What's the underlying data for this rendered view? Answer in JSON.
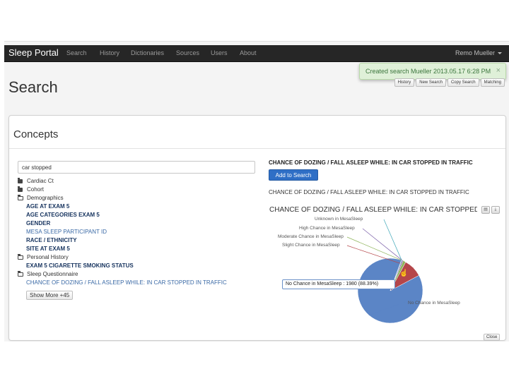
{
  "navbar": {
    "brand": "Sleep Portal",
    "items": [
      "Search",
      "History",
      "Dictionaries",
      "Sources",
      "Users",
      "About"
    ],
    "user": "Remo Mueller"
  },
  "toast": {
    "message": "Created search Mueller 2013.05.17 6:28 PM",
    "close": "×"
  },
  "page": {
    "title": "Search",
    "buttons": [
      "History",
      "New Search",
      "Copy Search",
      "Matching"
    ]
  },
  "concepts": {
    "title": "Concepts",
    "search_value": "car stopped",
    "tree": [
      {
        "label": "Cardiac Ct",
        "kind": "folder-closed"
      },
      {
        "label": "Cohort",
        "kind": "folder-closed"
      },
      {
        "label": "Demographics",
        "kind": "folder-open"
      },
      {
        "label": "AGE AT EXAM 5",
        "kind": "child"
      },
      {
        "label": "AGE CATEGORIES EXAM 5",
        "kind": "child"
      },
      {
        "label": "GENDER",
        "kind": "child"
      },
      {
        "label": "MESA SLEEP PARTICIPANT ID",
        "kind": "child-link"
      },
      {
        "label": "RACE / ETHNICITY",
        "kind": "child"
      },
      {
        "label": "SITE AT EXAM 5",
        "kind": "child"
      },
      {
        "label": "Personal History",
        "kind": "folder-open"
      },
      {
        "label": "EXAM 5 CIGARETTE SMOKING STATUS",
        "kind": "child"
      },
      {
        "label": "Sleep Questionnaire",
        "kind": "folder-open"
      },
      {
        "label": "CHANCE OF DOZING / FALL ASLEEP WHILE: IN CAR STOPPED IN TRAFFIC",
        "kind": "child-link"
      }
    ],
    "show_more": "Show More +45"
  },
  "variable": {
    "title": "CHANCE OF DOZING / FALL ASLEEP WHILE: IN CAR STOPPED IN TRAFFIC",
    "add_button": "Add to Search",
    "description": "CHANCE OF DOZING / FALL ASLEEP WHILE: IN CAR STOPPED IN TRAFFIC"
  },
  "chart_data": {
    "type": "pie",
    "title": "CHANCE OF DOZING / FALL ASLEEP WHILE: IN CAR STOPPED IN TRAFFIC",
    "slices": [
      {
        "name": "No Chance in MesaSleep",
        "value": 88.39,
        "color": "#5b85c6"
      },
      {
        "name": "Slight Chance in MesaSleep",
        "value": 9.3,
        "color": "#b5464a"
      },
      {
        "name": "Moderate Chance in MesaSleep",
        "value": 1.4,
        "color": "#8fb45c"
      },
      {
        "name": "High Chance in MesaSleep",
        "value": 0.6,
        "color": "#7a5ea8"
      },
      {
        "name": "Unknown in MesaSleep",
        "value": 0.31,
        "color": "#3fa7b8"
      }
    ],
    "tooltip": "No Chance in MesaSleep : 1980 (88.39%)",
    "legend": "none"
  },
  "footer": {
    "close_label": "Close"
  },
  "colors": {
    "navbar": "#262626",
    "primary": "#2f6fc6",
    "toast_bg": "#dff0d8"
  }
}
